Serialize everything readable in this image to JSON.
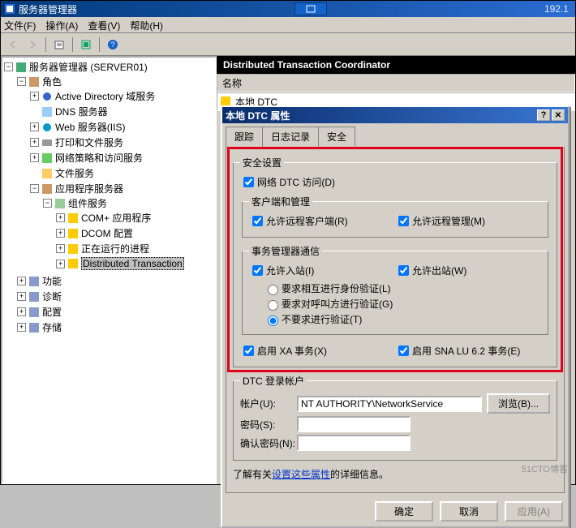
{
  "window": {
    "title": "服务器管理器",
    "ip": "192.1"
  },
  "menu": {
    "file": "文件(F)",
    "action": "操作(A)",
    "view": "查看(V)",
    "help": "帮助(H)"
  },
  "tree": {
    "root": "服务器管理器 (SERVER01)",
    "roles": "角色",
    "ad": "Active Directory 域服务",
    "dns": "DNS 服务器",
    "iis": "Web 服务器(IIS)",
    "print": "打印和文件服务",
    "netpolicy": "网络策略和访问服务",
    "fileserver": "文件服务",
    "appserver": "应用程序服务器",
    "compserv": "组件服务",
    "complus": "COM+ 应用程序",
    "dcom": "DCOM 配置",
    "running": "正在运行的进程",
    "dtc": "Distributed Transaction",
    "features": "功能",
    "diag": "诊断",
    "config": "配置",
    "storage": "存储"
  },
  "rightpane": {
    "header": "Distributed Transaction Coordinator",
    "col_name": "名称",
    "local_dtc": "本地 DTC"
  },
  "dialog": {
    "title": "本地 DTC 属性",
    "tab_trace": "跟踪",
    "tab_log": "日志记录",
    "tab_security": "安全",
    "grp_security": "安全设置",
    "chk_network": "网络 DTC 访问(D)",
    "grp_client": "客户端和管理",
    "chk_remote_client": "允许远程客户端(R)",
    "chk_remote_admin": "允许远程管理(M)",
    "grp_tm": "事务管理器通信",
    "chk_inbound": "允许入站(I)",
    "chk_outbound": "允许出站(W)",
    "rad_mutual": "要求相互进行身份验证(L)",
    "rad_caller": "要求对呼叫方进行验证(G)",
    "rad_noauth": "不要求进行验证(T)",
    "chk_xa": "启用 XA 事务(X)",
    "chk_sna": "启用 SNA LU 6.2 事务(E)",
    "grp_account": "DTC 登录帐户",
    "lbl_account": "帐户(U):",
    "val_account": "NT AUTHORITY\\NetworkService",
    "btn_browse": "浏览(B)...",
    "lbl_pwd": "密码(S):",
    "lbl_pwd2": "确认密码(N):",
    "info_prefix": "了解有关",
    "info_link": "设置这些属性",
    "info_suffix": "的详细信息。",
    "btn_ok": "确定",
    "btn_cancel": "取消",
    "btn_apply": "应用(A)"
  },
  "checks": {
    "network": true,
    "remote_client": true,
    "remote_admin": true,
    "inbound": true,
    "outbound": true,
    "xa": true,
    "sna": true,
    "auth": "noauth"
  }
}
